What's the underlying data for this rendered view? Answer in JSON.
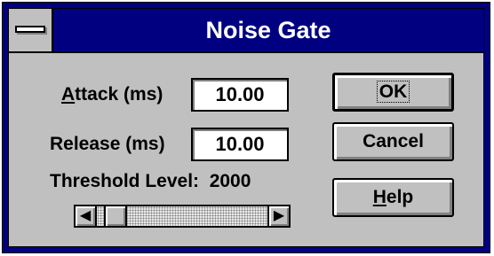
{
  "window": {
    "title": "Noise Gate",
    "system_menu_icon": "system-menu-icon"
  },
  "fields": {
    "attack": {
      "label_prefix": "A",
      "label_rest": "ttack (ms)",
      "value": "10.00"
    },
    "release": {
      "label": "Release (ms)",
      "value": "10.00"
    }
  },
  "threshold": {
    "label": "Threshold Level:",
    "value": "2000",
    "slider_fraction": 0.05
  },
  "scrollbar": {
    "left_icon": "arrow-left-icon",
    "right_icon": "arrow-right-icon",
    "left_glyph": "◆",
    "right_glyph": "➜"
  },
  "buttons": {
    "ok": "OK",
    "cancel": "Cancel",
    "help_prefix": "H",
    "help_rest": "elp"
  },
  "colors": {
    "titlebar": "#000080",
    "face": "#c0c0c0"
  }
}
